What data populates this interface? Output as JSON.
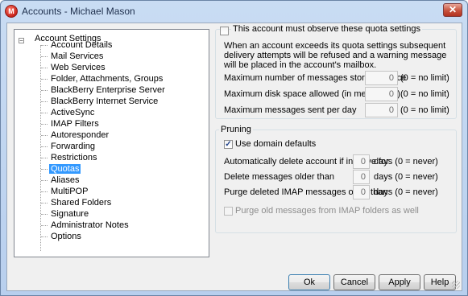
{
  "window": {
    "title": "Accounts - Michael Mason",
    "close_glyph": "✕",
    "app_icon_glyph": "M"
  },
  "tree": {
    "expander_glyph": "−",
    "root_label": "Account Settings",
    "items": [
      {
        "label": "Account Details"
      },
      {
        "label": "Mail Services"
      },
      {
        "label": "Web Services"
      },
      {
        "label": "Folder, Attachments, Groups"
      },
      {
        "label": "BlackBerry Enterprise Server"
      },
      {
        "label": "BlackBerry Internet Service"
      },
      {
        "label": "ActiveSync"
      },
      {
        "label": "IMAP Filters"
      },
      {
        "label": "Autoresponder"
      },
      {
        "label": "Forwarding"
      },
      {
        "label": "Restrictions"
      },
      {
        "label": "Quotas",
        "selected": true
      },
      {
        "label": "Aliases"
      },
      {
        "label": "MultiPOP"
      },
      {
        "label": "Shared Folders"
      },
      {
        "label": "Signature"
      },
      {
        "label": "Administrator Notes"
      },
      {
        "label": "Options"
      }
    ]
  },
  "quota": {
    "checkbox_label": "This account must observe these quota settings",
    "checked": false,
    "description": "When an account exceeds its quota settings subsequent delivery attempts will be refused and a warning message will be placed in the account's mailbox.",
    "rows": [
      {
        "label": "Maximum number of messages stored at once",
        "value": "0",
        "suffix": "(0 = no limit)"
      },
      {
        "label": "Maximum disk space allowed (in megabytes)",
        "value": "0",
        "suffix": "(0 = no limit)"
      },
      {
        "label": "Maximum messages sent per day",
        "value": "0",
        "suffix": "(0 = no limit)"
      }
    ]
  },
  "pruning": {
    "title": "Pruning",
    "use_defaults_label": "Use domain defaults",
    "use_defaults_checked": true,
    "check_glyph": "✓",
    "rows": [
      {
        "label": "Automatically delete account if inactive for",
        "value": "0",
        "suffix": "days (0 = never)"
      },
      {
        "label": "Delete messages older than",
        "value": "0",
        "suffix": "days (0 = never)"
      },
      {
        "label": "Purge deleted IMAP messages older than",
        "value": "0",
        "suffix": "days (0 = never)"
      }
    ],
    "purge_imap_label": "Purge old messages from IMAP folders as well",
    "purge_imap_checked": false
  },
  "buttons": {
    "ok": "Ok",
    "cancel": "Cancel",
    "apply": "Apply",
    "help": "Help"
  }
}
